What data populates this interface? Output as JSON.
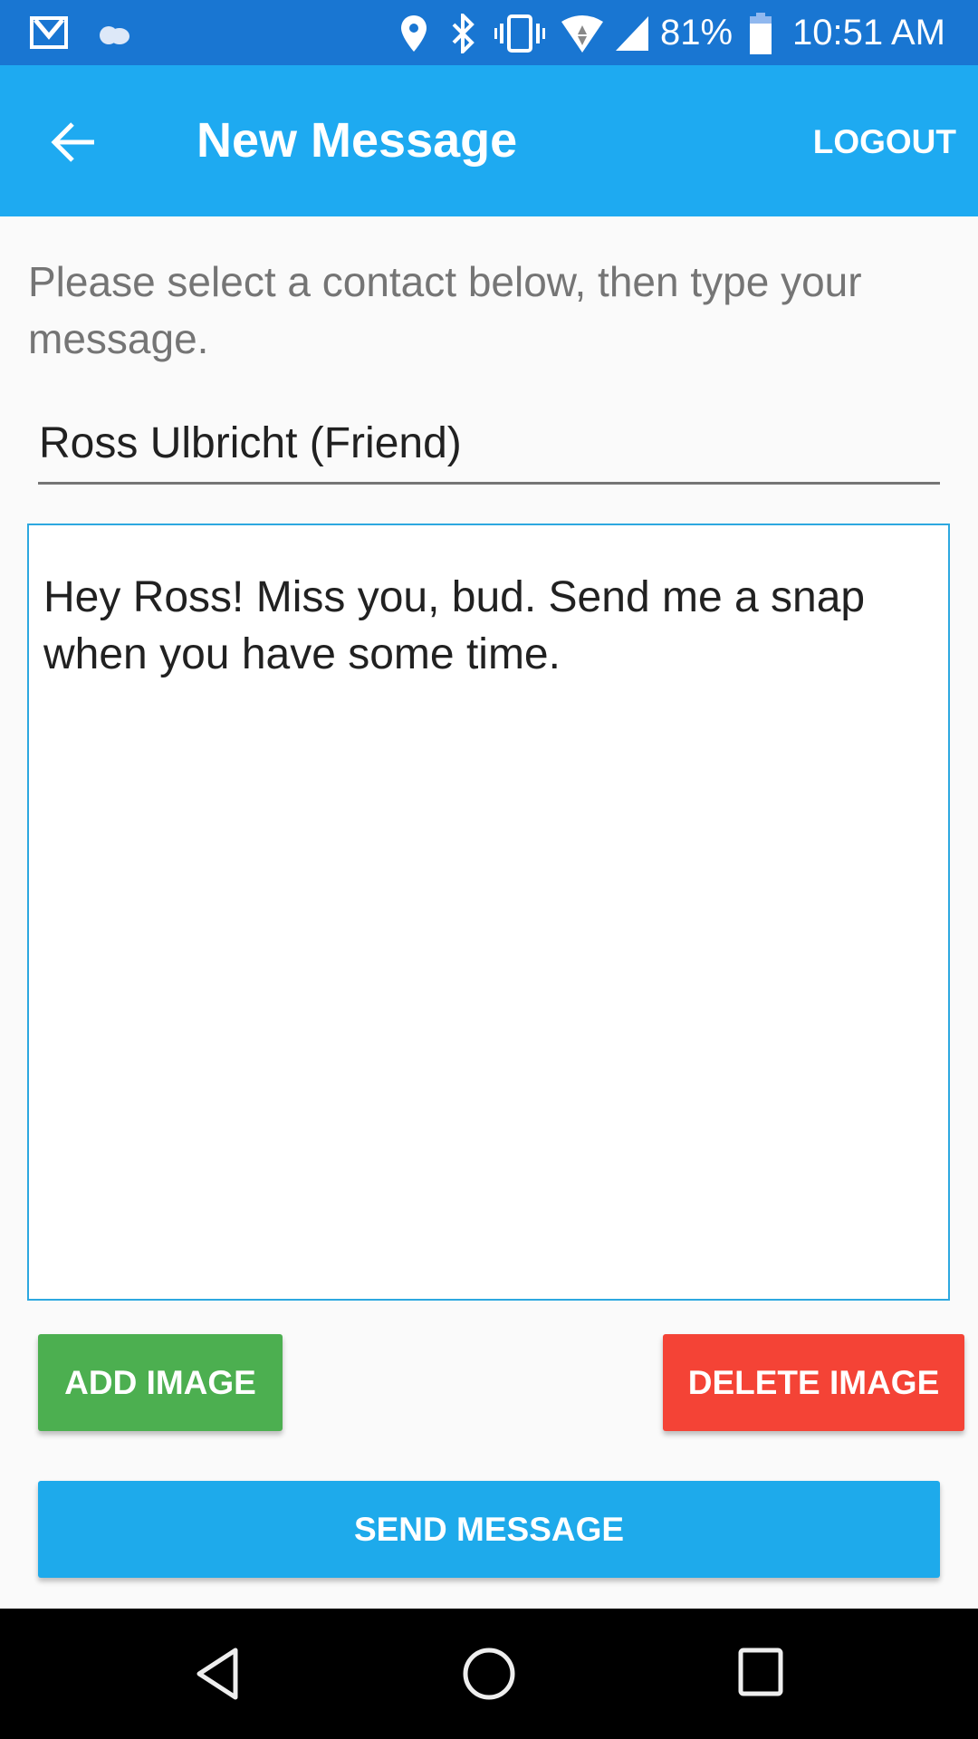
{
  "status_bar": {
    "battery": "81%",
    "time": "10:51 AM",
    "icons": [
      "gmail-icon",
      "cloud-icon",
      "location-icon",
      "bluetooth-icon",
      "vibrate-icon",
      "wifi-icon",
      "signal-icon",
      "battery-icon"
    ]
  },
  "toolbar": {
    "title": "New Message",
    "logout_label": "LOGOUT",
    "back_icon": "arrow-back-icon"
  },
  "main": {
    "instructions": "Please select a contact below, then type your message.",
    "contact_selected": "Ross Ulbricht (Friend)",
    "message_text": "Hey Ross! Miss you, bud. Send me a snap when you have some time.",
    "add_image_label": "ADD IMAGE",
    "delete_image_label": "DELETE IMAGE",
    "send_label": "SEND MESSAGE"
  },
  "colors": {
    "status_bar": "#1976D2",
    "toolbar": "#1EAAF1",
    "add_button": "#4CAF50",
    "delete_button": "#F44336",
    "send_button": "#1EAAEB"
  }
}
